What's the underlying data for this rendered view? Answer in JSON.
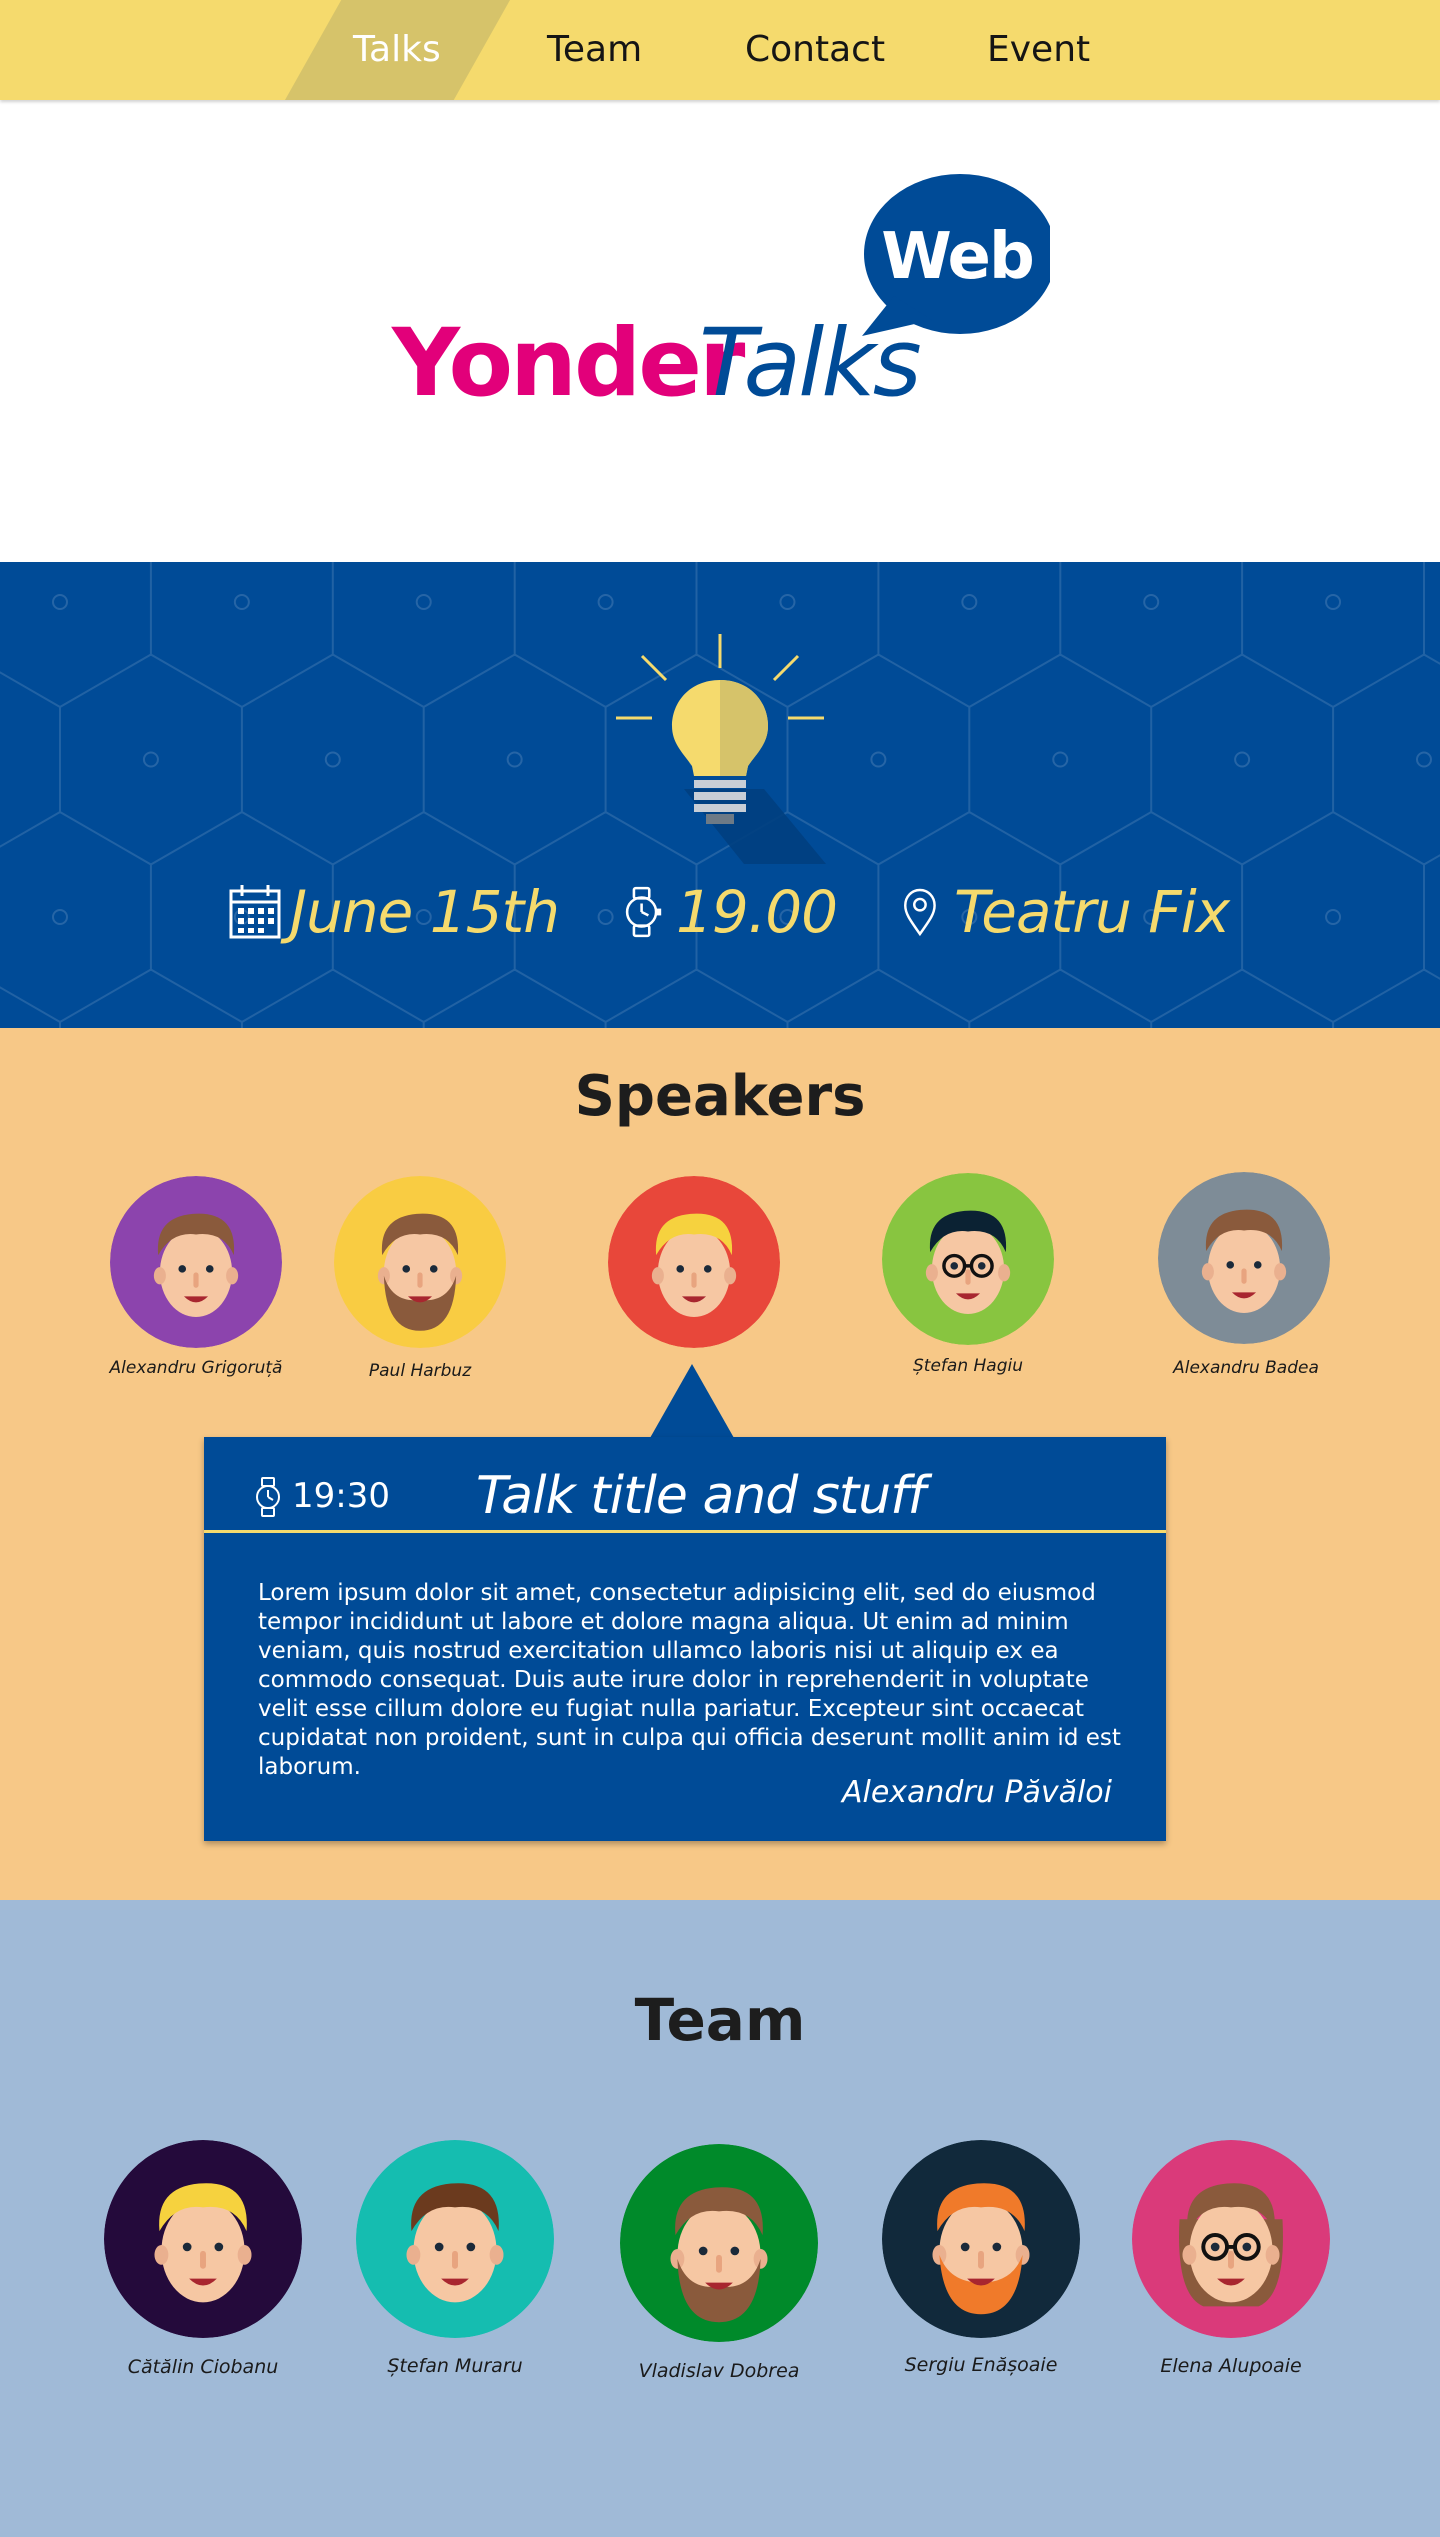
{
  "nav": {
    "items": [
      {
        "label": "Talks",
        "active": true
      },
      {
        "label": "Team",
        "active": false
      },
      {
        "label": "Contact",
        "active": false
      },
      {
        "label": "Event",
        "active": false
      }
    ]
  },
  "logo": {
    "part1": "Yonder",
    "part2": "Talks",
    "bubble": "Web"
  },
  "event": {
    "date": "June 15th",
    "time": "19.00",
    "location": "Teatru Fix"
  },
  "speakers": {
    "title": "Speakers",
    "people": [
      {
        "name": "Alexandru Grigoruță",
        "icon": "avatar-speaker-1",
        "color": "#8c44ad"
      },
      {
        "name": "Paul Harbuz",
        "icon": "avatar-speaker-2",
        "color": "#f9cc42"
      },
      {
        "name": "",
        "icon": "avatar-speaker-3",
        "color": "#e8473a"
      },
      {
        "name": "Ștefan Hagiu",
        "icon": "avatar-speaker-4",
        "color": "#88c540"
      },
      {
        "name": "Alexandru Badea",
        "icon": "avatar-speaker-5",
        "color": "#7e8c97"
      }
    ],
    "talk": {
      "time": "19:30",
      "title": "Talk title and stuff",
      "body": "Lorem ipsum dolor sit amet, consectetur adipisicing elit, sed do eiusmod tempor incididunt ut labore et dolore magna aliqua. Ut enim ad minim veniam, quis nostrud exercitation ullamco laboris nisi ut aliquip ex ea commodo consequat. Duis aute irure dolor in reprehenderit in voluptate velit esse cillum dolore eu fugiat nulla pariatur. Excepteur sint occaecat cupidatat non proident, sunt in culpa qui officia deserunt mollit anim id est laborum.",
      "author": "Alexandru Păvăloi"
    }
  },
  "team": {
    "title": "Team",
    "people": [
      {
        "name": "Cătălin Ciobanu",
        "icon": "avatar-team-1",
        "color": "#240a3b"
      },
      {
        "name": "Ștefan Muraru",
        "icon": "avatar-team-2",
        "color": "#15bdb0"
      },
      {
        "name": "Vladislav Dobrea",
        "icon": "avatar-team-3",
        "color": "#008a2a"
      },
      {
        "name": "Sergiu Enășoaie",
        "icon": "avatar-team-4",
        "color": "#11293b"
      },
      {
        "name": "Elena Alupoaie",
        "icon": "avatar-team-5",
        "color": "#da3a7a"
      }
    ]
  },
  "colors": {
    "nav": "#f5da6d",
    "brand_blue": "#004b97",
    "brand_pink": "#e2007a",
    "accent_yellow": "#f5da6d",
    "speakers_bg": "#f7c887",
    "team_bg": "#a0bad7"
  }
}
